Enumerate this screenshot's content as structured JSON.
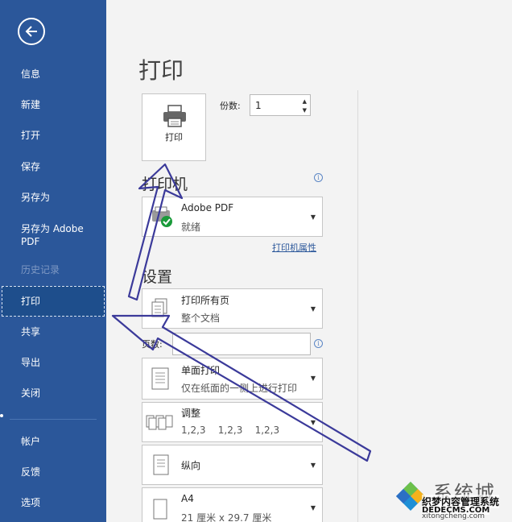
{
  "sidebar": {
    "items": [
      {
        "label": "信息",
        "state": "normal"
      },
      {
        "label": "新建",
        "state": "normal"
      },
      {
        "label": "打开",
        "state": "normal"
      },
      {
        "label": "保存",
        "state": "normal"
      },
      {
        "label": "另存为",
        "state": "normal"
      },
      {
        "label": "另存为 Adobe PDF",
        "state": "normal"
      },
      {
        "label": "历史记录",
        "state": "disabled"
      },
      {
        "label": "打印",
        "state": "active"
      },
      {
        "label": "共享",
        "state": "normal"
      },
      {
        "label": "导出",
        "state": "normal"
      },
      {
        "label": "关闭",
        "state": "normal"
      },
      {
        "label": "帐户",
        "state": "normal"
      },
      {
        "label": "反馈",
        "state": "normal"
      },
      {
        "label": "选项",
        "state": "normal"
      }
    ]
  },
  "main": {
    "title": "打印",
    "print_button_label": "打印",
    "copies_label": "份数:",
    "copies_value": "1",
    "printer_heading": "打印机",
    "printer_name": "Adobe PDF",
    "printer_status": "就绪",
    "printer_properties_link": "打印机属性",
    "settings_heading": "设置",
    "pages_label": "页数:",
    "pages_value": "",
    "settings": [
      {
        "line1": "打印所有页",
        "line2": "整个文档"
      },
      {
        "line1": "单面打印",
        "line2": "仅在纸面的一侧上进行打印"
      },
      {
        "line1": "调整",
        "line2": "1,2,3    1,2,3    1,2,3"
      },
      {
        "line1": "纵向",
        "line2": ""
      },
      {
        "line1": "A4",
        "line2": "21 厘米 x 29.7 厘米"
      }
    ]
  },
  "watermark": {
    "brand": "系统城",
    "url": "xitongcheng.com",
    "overlay_line1": "织梦内容管理系统",
    "overlay_line2": "DEDECMS.COM"
  },
  "colors": {
    "sidebar_bg": "#2b579a",
    "annotation_arrow": "#3b3a9a"
  },
  "icons": {
    "back": "back-arrow-icon",
    "printer": "printer-icon",
    "info": "info-icon",
    "dropdown": "chevron-down-icon"
  }
}
